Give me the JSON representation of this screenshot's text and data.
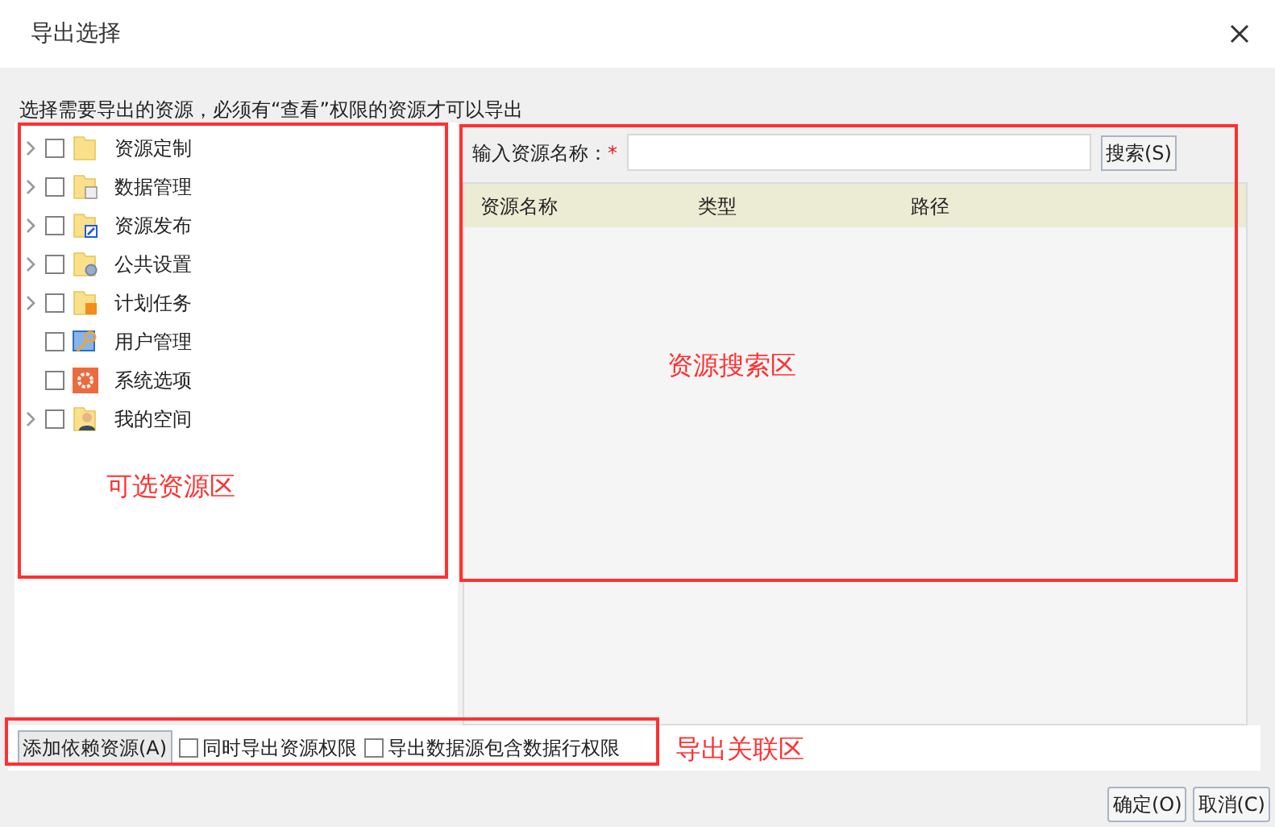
{
  "window": {
    "title": "导出选择"
  },
  "instruction": "选择需要导出的资源，必须有“查看”权限的资源才可以导出",
  "tree": [
    {
      "label": "资源定制",
      "kind": "folder",
      "has_children": true,
      "checked": false
    },
    {
      "label": "数据管理",
      "kind": "data",
      "has_children": true,
      "checked": false
    },
    {
      "label": "资源发布",
      "kind": "publish",
      "has_children": true,
      "checked": false
    },
    {
      "label": "公共设置",
      "kind": "settings",
      "has_children": true,
      "checked": false
    },
    {
      "label": "计划任务",
      "kind": "task",
      "has_children": true,
      "checked": false
    },
    {
      "label": "用户管理",
      "kind": "users",
      "has_children": false,
      "checked": false
    },
    {
      "label": "系统选项",
      "kind": "system",
      "has_children": false,
      "checked": false
    },
    {
      "label": "我的空间",
      "kind": "space",
      "has_children": true,
      "checked": false
    }
  ],
  "search": {
    "label": "输入资源名称：",
    "required_mark": "*",
    "button": "搜索(S)"
  },
  "table": {
    "columns": [
      "资源名称",
      "类型",
      "路径"
    ]
  },
  "bottom": {
    "button": "添加依赖资源(A)",
    "options": [
      {
        "label": "同时导出资源权限",
        "checked": false
      },
      {
        "label": "导出数据源包含数据行权限",
        "checked": false
      }
    ]
  },
  "buttons": [
    "确定(O)",
    "取消(C)"
  ],
  "annotations": [
    "可选资源区",
    "资源搜索区",
    "导出关联区"
  ]
}
